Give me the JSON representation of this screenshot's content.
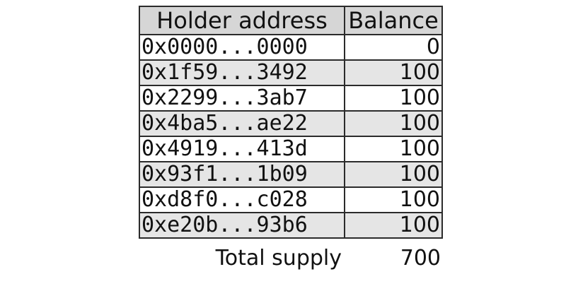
{
  "table": {
    "headers": {
      "address": "Holder address",
      "balance": "Balance"
    },
    "rows": [
      {
        "address": "0x0000...0000",
        "balance": "0"
      },
      {
        "address": "0x1f59...3492",
        "balance": "100"
      },
      {
        "address": "0x2299...3ab7",
        "balance": "100"
      },
      {
        "address": "0x4ba5...ae22",
        "balance": "100"
      },
      {
        "address": "0x4919...413d",
        "balance": "100"
      },
      {
        "address": "0x93f1...1b09",
        "balance": "100"
      },
      {
        "address": "0xd8f0...c028",
        "balance": "100"
      },
      {
        "address": "0xe20b...93b6",
        "balance": "100"
      }
    ],
    "footer": {
      "label": "Total supply",
      "value": "700"
    }
  },
  "colors": {
    "header_bg": "#d6d6d6",
    "stripe_bg": "#e5e5e5",
    "border": "#2b2b2b"
  }
}
